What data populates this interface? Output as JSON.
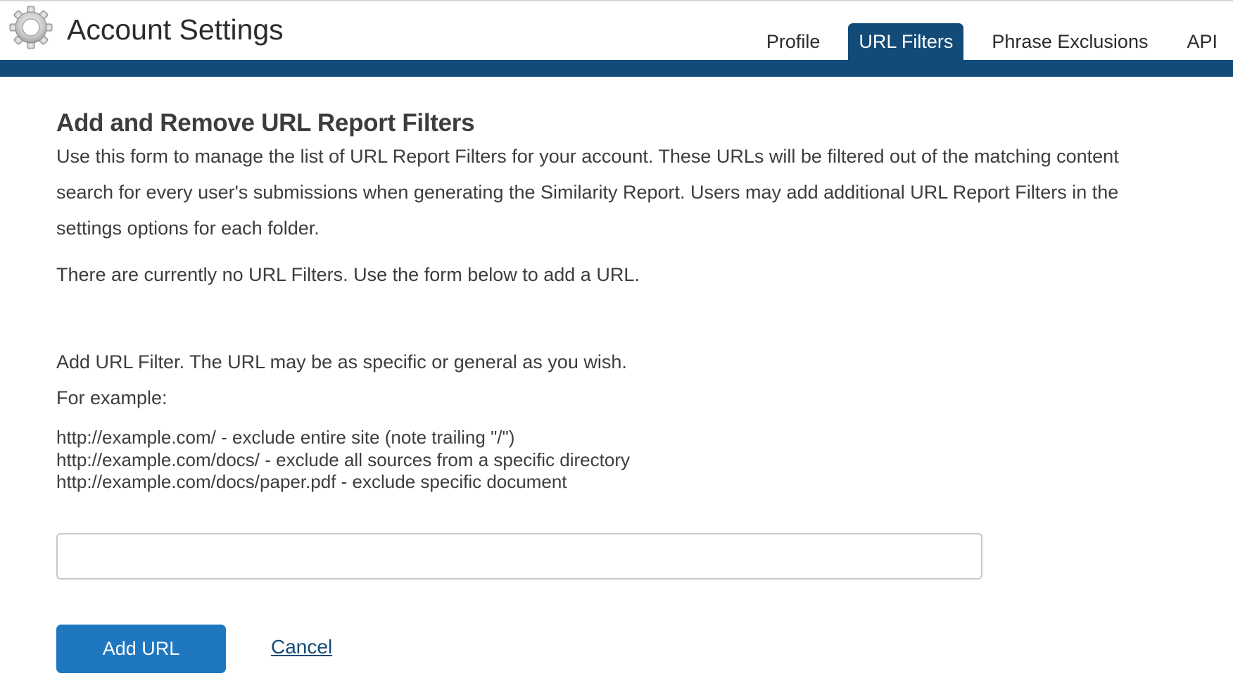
{
  "header": {
    "title": "Account Settings",
    "icon": "gear-icon",
    "tabs": [
      {
        "label": "Profile",
        "active": false
      },
      {
        "label": "URL Filters",
        "active": true
      },
      {
        "label": "Phrase Exclusions",
        "active": false
      },
      {
        "label": "API",
        "active": false
      }
    ]
  },
  "main": {
    "title": "Add and Remove URL Report Filters",
    "intro_lines": [
      "Use this form to manage the list of URL Report Filters for your account. These URLs will be filtered out of the matching content",
      "search for every user's submissions when generating the Similarity Report. Users may add additional URL Report Filters in the",
      "settings options for each folder."
    ],
    "status": "There are currently no URL Filters. Use the form below to add a URL.",
    "add_label": "Add URL Filter. The URL may be as specific or general as you wish.",
    "example_label": "For example:",
    "examples": [
      "http://example.com/ - exclude entire site (note trailing \"/\")",
      "http://example.com/docs/ - exclude all sources from a specific directory",
      "http://example.com/docs/paper.pdf - exclude specific document"
    ],
    "url_input": {
      "value": "",
      "placeholder": ""
    },
    "add_button": "Add URL",
    "cancel_link": "Cancel"
  },
  "colors": {
    "primary": "#124a78",
    "button": "#1f77c0",
    "text": "#3d3d3d"
  }
}
